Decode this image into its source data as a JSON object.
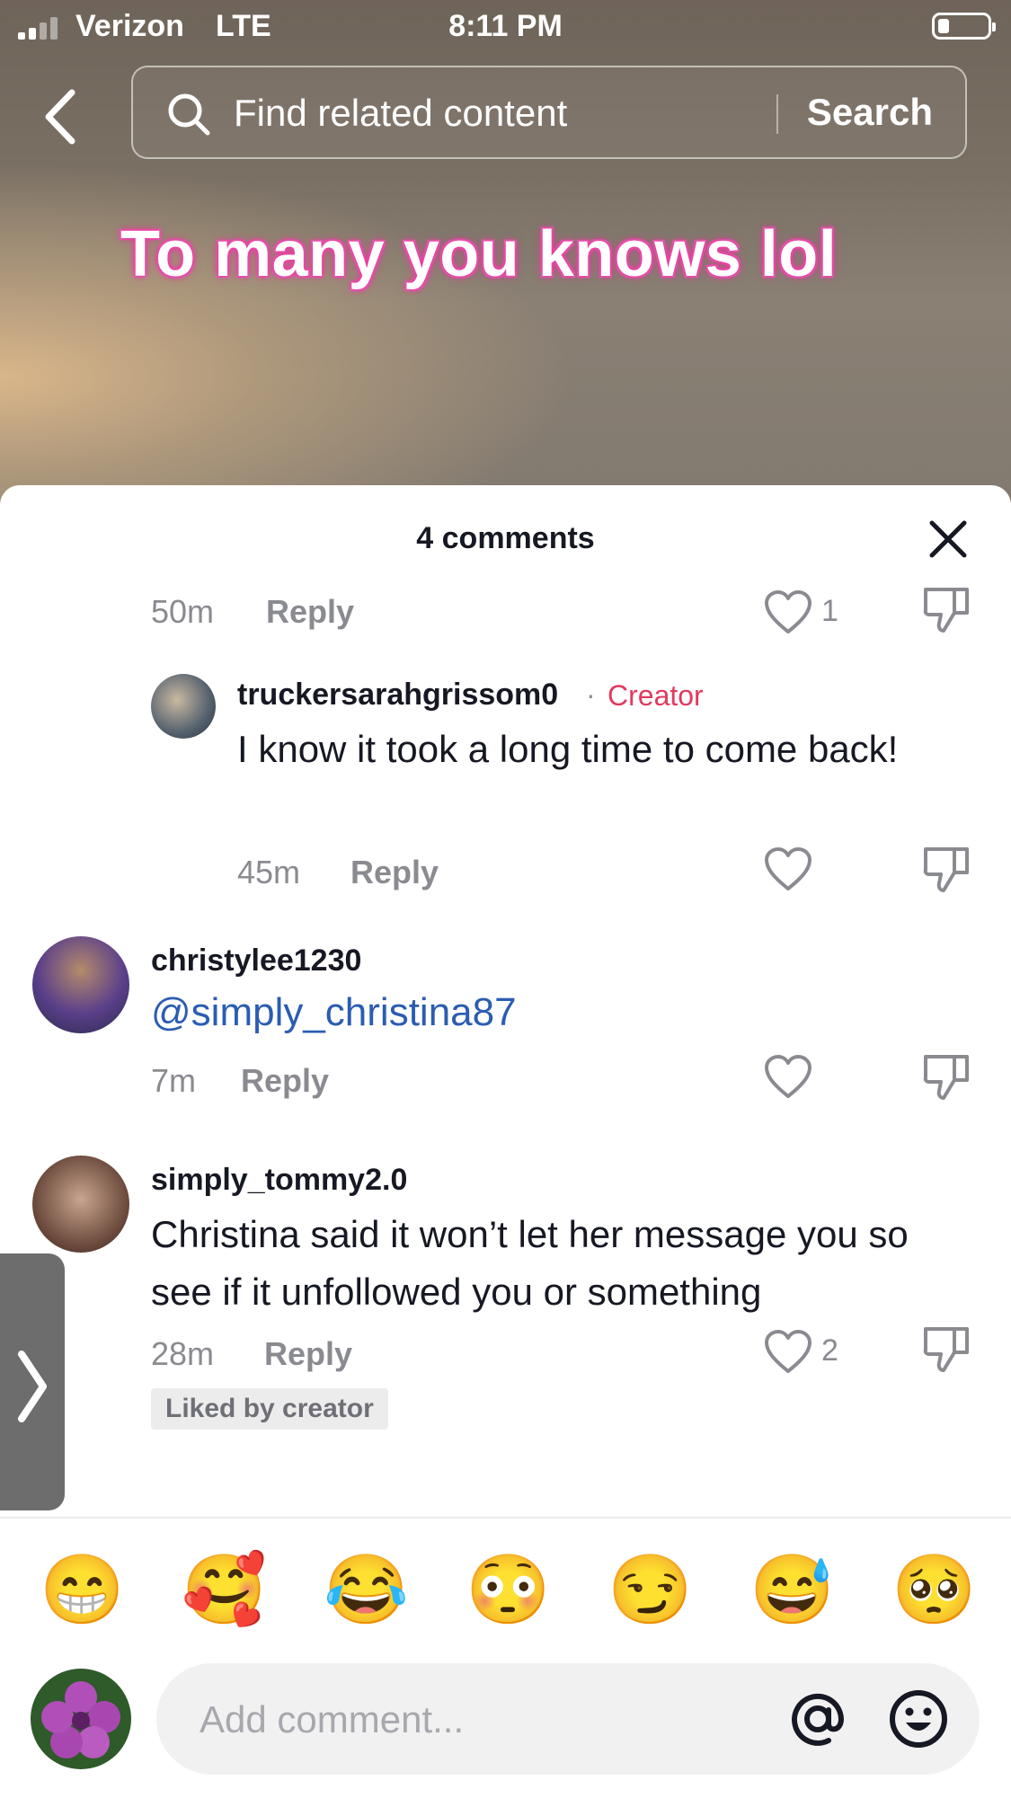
{
  "status_bar": {
    "carrier": "Verizon",
    "network": "LTE",
    "time": "8:11 PM"
  },
  "search": {
    "placeholder": "Find related content",
    "button_label": "Search"
  },
  "video": {
    "caption": "To many you knows lol"
  },
  "comments_sheet": {
    "title": "4 comments",
    "comments": [
      {
        "time": "50m",
        "reply_label": "Reply",
        "likes": "1"
      },
      {
        "username": "truckersarahgrissom0",
        "separator": "·",
        "badge": "Creator",
        "text": "I know it took a long time to come back!",
        "time": "45m",
        "reply_label": "Reply"
      },
      {
        "username": "christylee1230",
        "text": "@simply_christina87",
        "time": "7m",
        "reply_label": "Reply"
      },
      {
        "username": "simply_tommy2.0",
        "text": "Christina said it won’t let her message you so see if it unfollowed you or something",
        "time": "28m",
        "reply_label": "Reply",
        "likes": "2",
        "badge": "Liked by creator"
      }
    ]
  },
  "emoji_bar": [
    "😁",
    "🥰",
    "😂",
    "😳",
    "😏",
    "😅",
    "🥺"
  ],
  "composer": {
    "placeholder": "Add comment...",
    "mention_icon": "at-icon",
    "emoji_icon": "smiley-icon"
  },
  "colors": {
    "creator": "#e13a5f",
    "mention": "#2b5db1",
    "text_primary": "#161823",
    "text_secondary": "#8a8b91"
  }
}
